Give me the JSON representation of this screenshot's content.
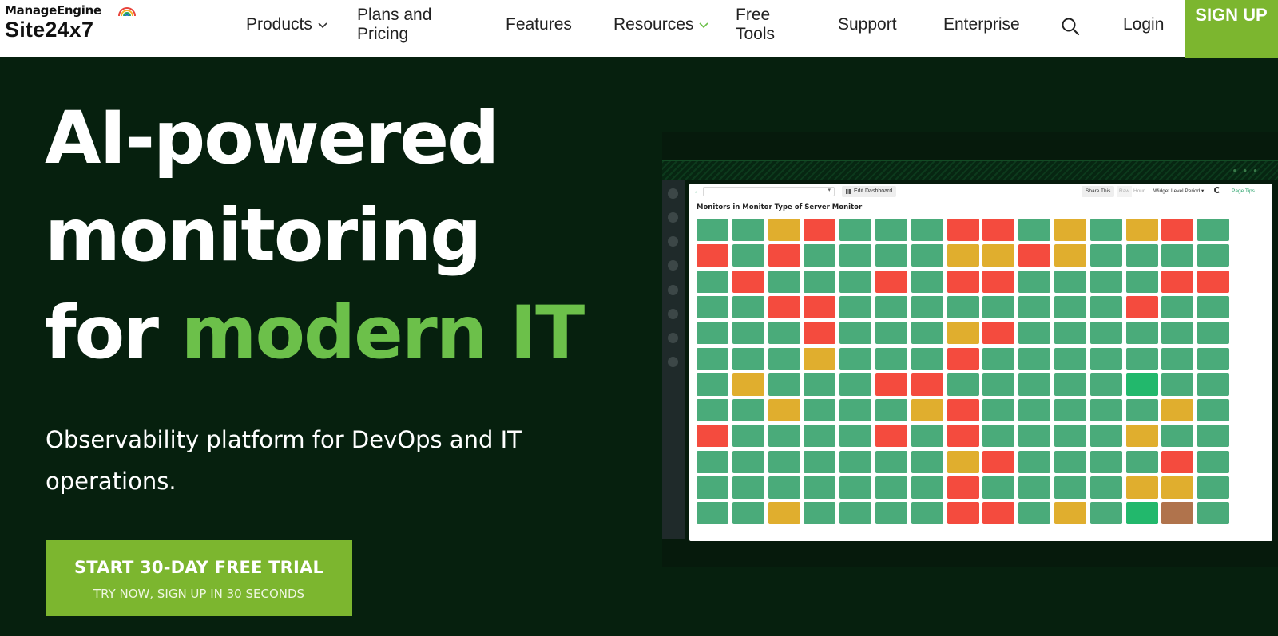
{
  "nav": {
    "brand_top": "ManageEngine",
    "brand_bottom": "Site24x7",
    "items": [
      {
        "label": "Products",
        "has_dropdown": true
      },
      {
        "label": "Plans and Pricing",
        "has_dropdown": false
      },
      {
        "label": "Features",
        "has_dropdown": false
      },
      {
        "label": "Resources",
        "has_dropdown": true
      },
      {
        "label": "Free Tools",
        "has_dropdown": false
      },
      {
        "label": "Support",
        "has_dropdown": false
      },
      {
        "label": "Enterprise",
        "has_dropdown": false
      }
    ],
    "search_icon": "search-icon",
    "login": "Login",
    "signup": "SIGN UP",
    "signup_color": "#7cb62f"
  },
  "hero": {
    "title_line1": "AI-powered",
    "title_line2": "monitoring",
    "title_line3_white": "for ",
    "title_line3_green": "modern IT",
    "accent_color": "#6cc04a",
    "subtitle": "Observability platform for DevOps and IT operations.",
    "cta_main": "START 30-DAY FREE TRIAL",
    "cta_sub": "TRY NOW, SIGN UP IN 30 SECONDS"
  },
  "dashboard": {
    "edit_button": "Edit Dashboard",
    "share_button": "Share This",
    "raw_label": "Raw",
    "hour_label": "Hour",
    "period_label": "Widget Level Period",
    "tips_label": "Page Tips",
    "widget_title": "Monitors in Monitor Type of Server Monitor",
    "status_colors": {
      "G": "#4aab7a",
      "R": "#f44b3e",
      "Y": "#e0ae2e",
      "D": "#22b86c",
      "B": "#b0734c"
    },
    "grid": [
      "GGYRGGGRRGYGYRG",
      "RGRGGGGYYRYGGGG",
      "GRGGGRGRRGGGGRR",
      "GGRRGGGGGGGGRGG",
      "GGGRGGGYRGGGGGG",
      "GGGYGGGRGGGGGGG",
      "GYGGGRRGGGGGDGG",
      "GGYGGGYRGGGGGYG",
      "RGGGGRGRGGGGYGG",
      "GGGGGGGYRGGGGRG",
      "GGGGGGGRGGGGYYG",
      "GGYGGGGRRGYGDBG"
    ]
  }
}
